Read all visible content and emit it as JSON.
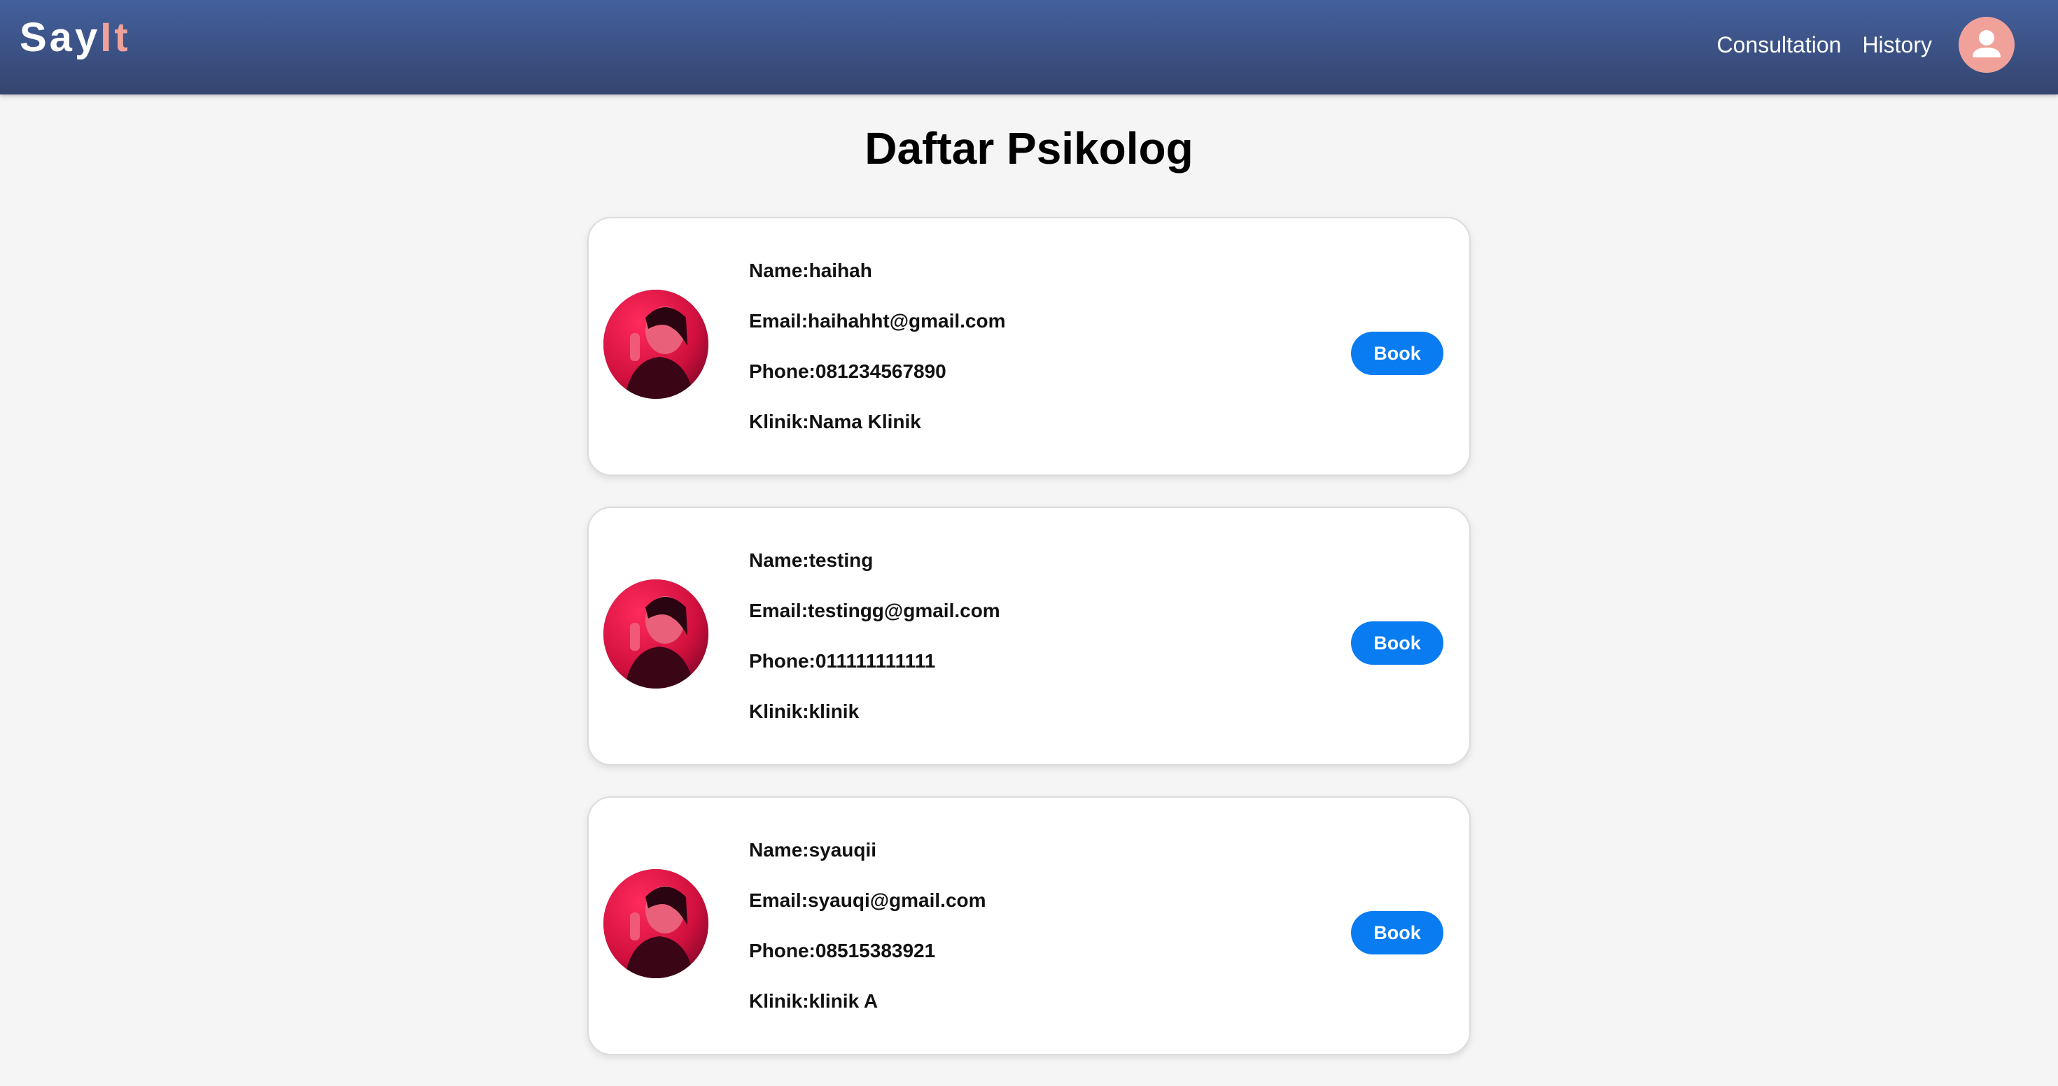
{
  "navbar": {
    "brand_say": "Say",
    "brand_it": "It",
    "links": [
      "Consultation",
      "History"
    ]
  },
  "page": {
    "title": "Daftar Psikolog"
  },
  "psychologists": [
    {
      "name_line": "Name:haihah",
      "email_line": "Email:haihahht@gmail.com",
      "phone_line": "Phone:081234567890",
      "klinik_line": "Klinik:Nama Klinik",
      "button": "Book"
    },
    {
      "name_line": "Name:testing",
      "email_line": "Email:testingg@gmail.com",
      "phone_line": "Phone:011111111111",
      "klinik_line": "Klinik:klinik",
      "button": "Book"
    },
    {
      "name_line": "Name:syauqii",
      "email_line": "Email:syauqi@gmail.com",
      "phone_line": "Phone:08515383921",
      "klinik_line": "Klinik:klinik A",
      "button": "Book"
    }
  ],
  "icons": {
    "profile": "user-avatar-icon",
    "photo": "psychologist-photo"
  },
  "colors": {
    "navbar_top": "#43609d",
    "navbar_bottom": "#35456f",
    "brand_accent": "#f0a29a",
    "book_button": "#0a7cf2",
    "background": "#f5f5f5"
  }
}
